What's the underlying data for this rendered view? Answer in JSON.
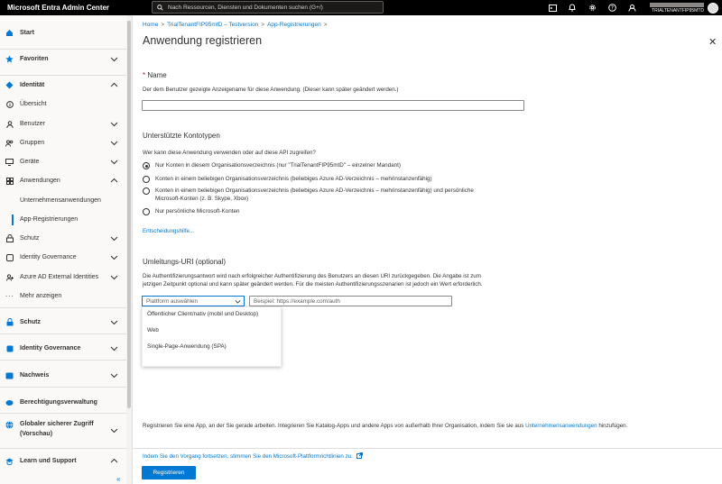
{
  "topbar": {
    "app_title": "Microsoft Entra Admin Center",
    "search_placeholder": "Nach Ressourcen, Diensten und Dokumenten suchen (G+/)",
    "account_tenant": "TRIALTENANTFIP95MTD",
    "icons": [
      "terminal-icon",
      "bell-icon",
      "gear-icon",
      "help-icon",
      "feedback-icon"
    ]
  },
  "sidebar": {
    "items": [
      {
        "label": "Start",
        "icon": "home-icon"
      },
      {
        "label": "Favoriten",
        "icon": "star-icon"
      },
      {
        "label": "Identität",
        "icon": "identity-icon"
      },
      {
        "label": "Übersicht",
        "icon": "info-icon"
      },
      {
        "label": "Benutzer",
        "icon": "user-icon"
      },
      {
        "label": "Gruppen",
        "icon": "group-icon"
      },
      {
        "label": "Geräte",
        "icon": "device-icon"
      },
      {
        "label": "Anwendungen",
        "icon": "apps-icon"
      },
      {
        "label": "Unternehmensanwendungen"
      },
      {
        "label": "App-Registrierungen"
      },
      {
        "label": "Schutz",
        "icon": "lock-icon"
      },
      {
        "label": "Identity Governance",
        "icon": "governance-icon"
      },
      {
        "label": "Azure AD External Identities",
        "icon": "external-icon"
      },
      {
        "label": "Mehr anzeigen",
        "icon": "more-icon"
      },
      {
        "label": "Schutz",
        "icon": "lock-icon"
      },
      {
        "label": "Identity Governance",
        "icon": "governance-icon"
      },
      {
        "label": "Nachweis",
        "icon": "credential-icon"
      },
      {
        "label": "Berechtigungsverwaltung",
        "icon": "permission-icon"
      },
      {
        "label": "Globaler sicherer Zugriff",
        "label2": "(Vorschau)",
        "icon": "globe-icon"
      },
      {
        "label": "Learn und Support",
        "icon": "learn-icon"
      }
    ],
    "collapse_label": "«"
  },
  "breadcrumb": {
    "items": [
      "Home",
      "TrialTenantFIP95mtD – Testversion",
      "App-Registrierungen"
    ],
    "separator": ">"
  },
  "page": {
    "title": "Anwendung registrieren",
    "close_label": "✕"
  },
  "name_section": {
    "required_mark": "*",
    "label": "Name",
    "description": "Der dem Benutzer gezeigte Anzeigename für diese Anwendung. (Dieser kann später geändert werden.)",
    "value": ""
  },
  "account_types": {
    "heading": "Unterstützte Kontotypen",
    "question": "Wer kann diese Anwendung verwenden oder auf diese API zugreifen?",
    "options": [
      {
        "label": "Nur Konten in diesem Organisationsverzeichnis (nur \"TrialTenantFIP95mtD\" – einzelner Mandant)",
        "checked": true
      },
      {
        "label": "Konten in einem beliebigen Organisationsverzeichnis (beliebiges Azure AD-Verzeichnis – mehrinstanzenfähig)",
        "checked": false
      },
      {
        "label": "Konten in einem beliebigen Organisationsverzeichnis (beliebiges Azure AD-Verzeichnis – mehrinstanzenfähig) und persönliche",
        "label2": "Microsoft-Konten (z. B. Skype, Xbox)",
        "checked": false
      },
      {
        "label": "Nur persönliche Microsoft-Konten",
        "checked": false
      }
    ],
    "help_link": "Entscheidungshilfe..."
  },
  "redirect_uri": {
    "heading": "Umleitungs-URI (optional)",
    "description_line1": "Die Authentifizierungsantwort wird nach erfolgreicher Authentifizierung des Benutzers an diesen URI zurückgegeben. Die Angabe ist zum",
    "description_line2": "jetzigen Zeitpunkt optional und kann später geändert werden. Für die meisten Authentifizierungsszenarien ist jedoch ein Wert erforderlich.",
    "platform_placeholder": "Plattform auswählen",
    "uri_placeholder": "Beispiel: https://example.com/auth",
    "platform_options": [
      "Öffentlicher Client/nativ (mobil und Desktop)",
      "Web",
      "Single-Page-Anwendung (SPA)"
    ]
  },
  "bottom_note": {
    "text": "Registrieren Sie eine App, an der Sie gerade arbeiten. Integrieren Sie Katalog-Apps und andere Apps von außerhalb Ihrer Organisation, indem Sie sie aus",
    "link": "Unternehmensanwendungen",
    "suffix": "hinzufügen."
  },
  "footer": {
    "policy_text": "Indem Sie den Vorgang fortsetzen, stimmen Sie den Microsoft-Plattformrichtlinien zu.",
    "register_button": "Registrieren"
  },
  "colors": {
    "accent": "#0078d4",
    "topbar": "#000000",
    "required": "#a4262c"
  }
}
